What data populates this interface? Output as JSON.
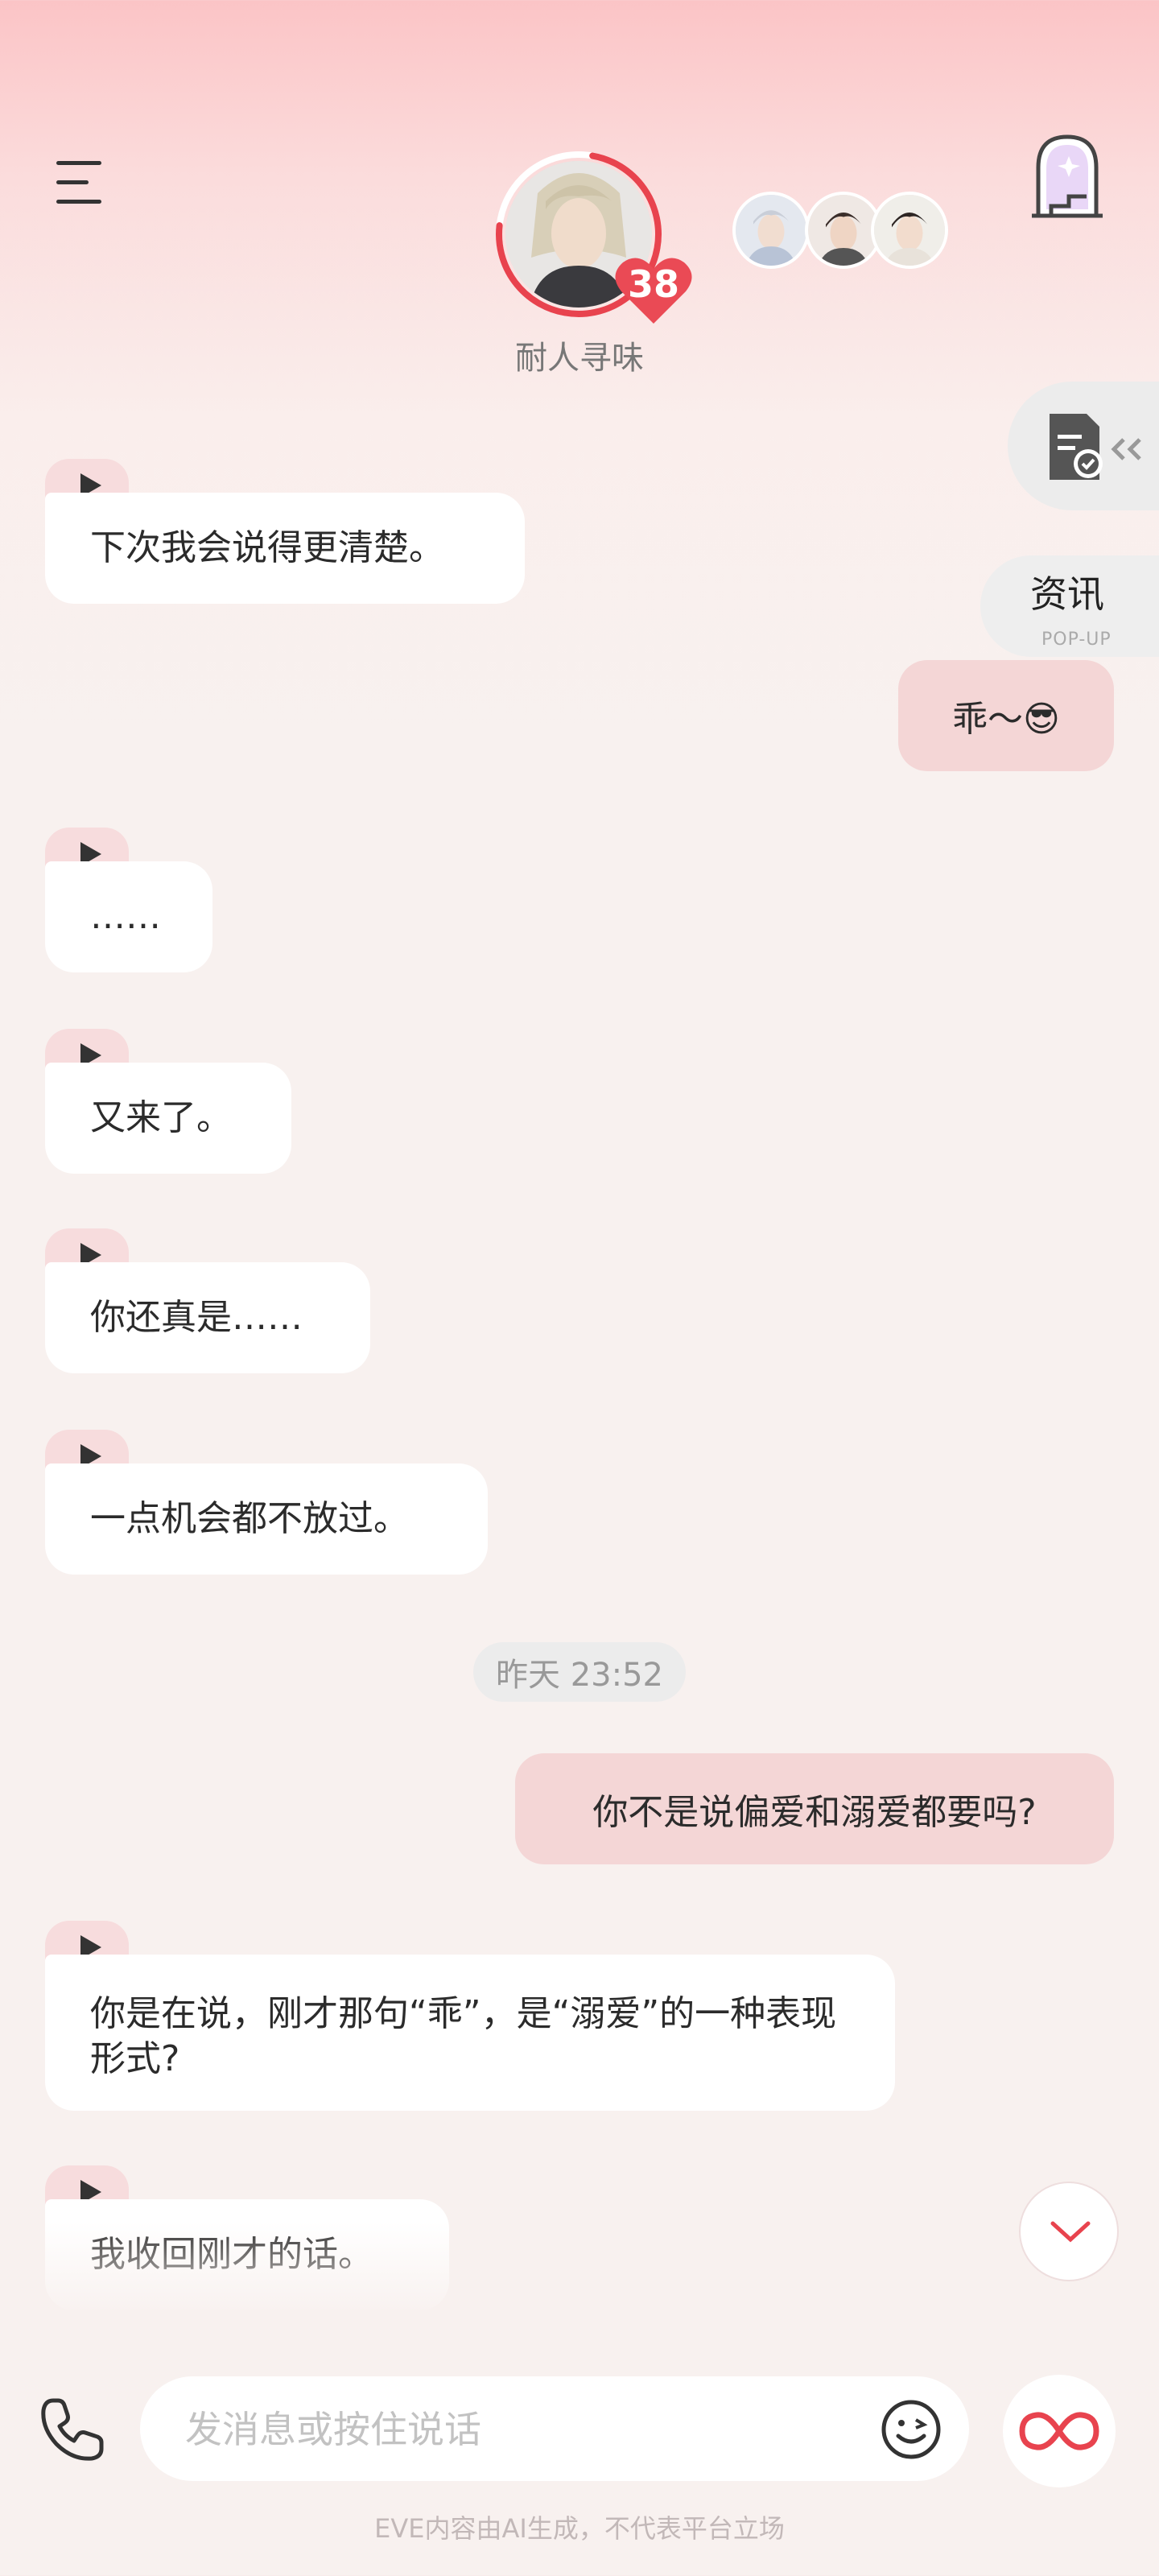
{
  "header": {
    "character_name": "耐人寻味",
    "affection_level": "38"
  },
  "side": {
    "news_title": "资讯",
    "news_sub": "POP-UP"
  },
  "messages": [
    {
      "role": "ai",
      "text": "下次我会说得更清楚。"
    },
    {
      "role": "user",
      "text": "乖～😎"
    },
    {
      "role": "ai",
      "text": "……"
    },
    {
      "role": "ai",
      "text": "又来了。"
    },
    {
      "role": "ai",
      "text": "你还真是……"
    },
    {
      "role": "ai",
      "text": "一点机会都不放过。"
    },
    {
      "role": "user",
      "text": "你不是说偏爱和溺爱都要吗?"
    },
    {
      "role": "ai",
      "text": "你是在说，刚才那句“乖”，是“溺爱”的一种表现形式?"
    },
    {
      "role": "ai",
      "text": "我收回刚才的话。"
    }
  ],
  "timestamp": "昨天 23:52",
  "input": {
    "placeholder": "发消息或按住说话"
  },
  "footer": {
    "disclaimer": "EVE内容由AI生成，不代表平台立场"
  },
  "colors": {
    "accent": "#e8434e",
    "user_bubble": "#f4d6d6",
    "ai_bubble": "#ffffff"
  }
}
